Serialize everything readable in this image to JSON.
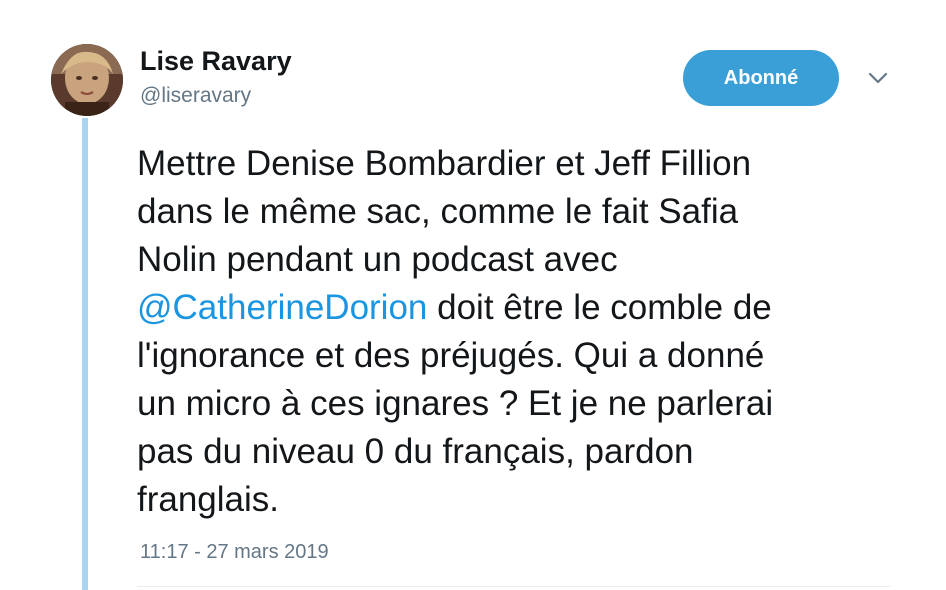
{
  "author": {
    "display_name": "Lise Ravary",
    "handle": "@liseravary"
  },
  "follow_button": {
    "label": "Abonné"
  },
  "menu": {
    "icon": "chevron-down-icon"
  },
  "tweet": {
    "lines": [
      {
        "text": "Mettre Denise Bombardier et Jeff Fillion"
      },
      {
        "text": "dans le même sac, comme le fait Safia"
      },
      {
        "text": "Nolin pendant un podcast avec"
      },
      {
        "mention": "@CatherineDorion",
        "text": " doit être le comble de"
      },
      {
        "text": "l'ignorance et des préjugés. Qui a donné"
      },
      {
        "text": "un micro à ces ignares ? Et je ne parlerai"
      },
      {
        "text": "pas du niveau 0 du français, pardon"
      },
      {
        "text": "franglais."
      }
    ],
    "timestamp": "11:17 - 27 mars 2019"
  },
  "colors": {
    "accent": "#1b95e0",
    "follow_button_bg": "#3a9fd6",
    "thread_line": "#a8d4ef",
    "text": "#14171a",
    "muted": "#657786"
  }
}
